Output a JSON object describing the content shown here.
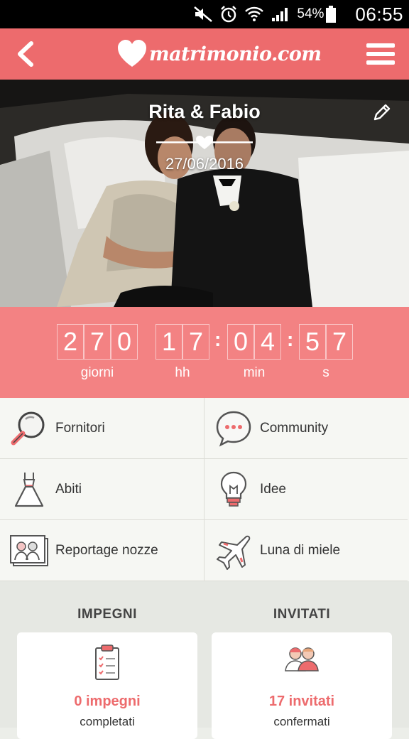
{
  "status_bar": {
    "battery": "54%",
    "time": "06:55"
  },
  "app_bar": {
    "logo_text": "matrimonio.com"
  },
  "hero": {
    "couple": "Rita & Fabio",
    "date": "27/06/2016"
  },
  "countdown": {
    "days": [
      "2",
      "7",
      "0"
    ],
    "hours": [
      "1",
      "7"
    ],
    "minutes": [
      "0",
      "4"
    ],
    "seconds": [
      "5",
      "7"
    ],
    "labels": {
      "days": "giorni",
      "hours": "hh",
      "minutes": "min",
      "seconds": "s"
    }
  },
  "menu": [
    {
      "label": "Fornitori",
      "icon": "magnifier-icon"
    },
    {
      "label": "Community",
      "icon": "chat-bubble-icon"
    },
    {
      "label": "Abiti",
      "icon": "dress-icon"
    },
    {
      "label": "Idee",
      "icon": "lightbulb-icon"
    },
    {
      "label": "Reportage nozze",
      "icon": "photo-album-icon"
    },
    {
      "label": "Luna di miele",
      "icon": "airplane-icon"
    }
  ],
  "tasks": {
    "title": "IMPEGNI",
    "value": "0 impegni",
    "caption": "completati"
  },
  "guests": {
    "title": "INVITATI",
    "value": "17 invitati",
    "caption": "confermati"
  },
  "colors": {
    "brand": "#ed6b6d",
    "countdown_bg": "#f38283",
    "grid_bg": "#f6f7f3",
    "section_bg": "#e6e8e3"
  }
}
